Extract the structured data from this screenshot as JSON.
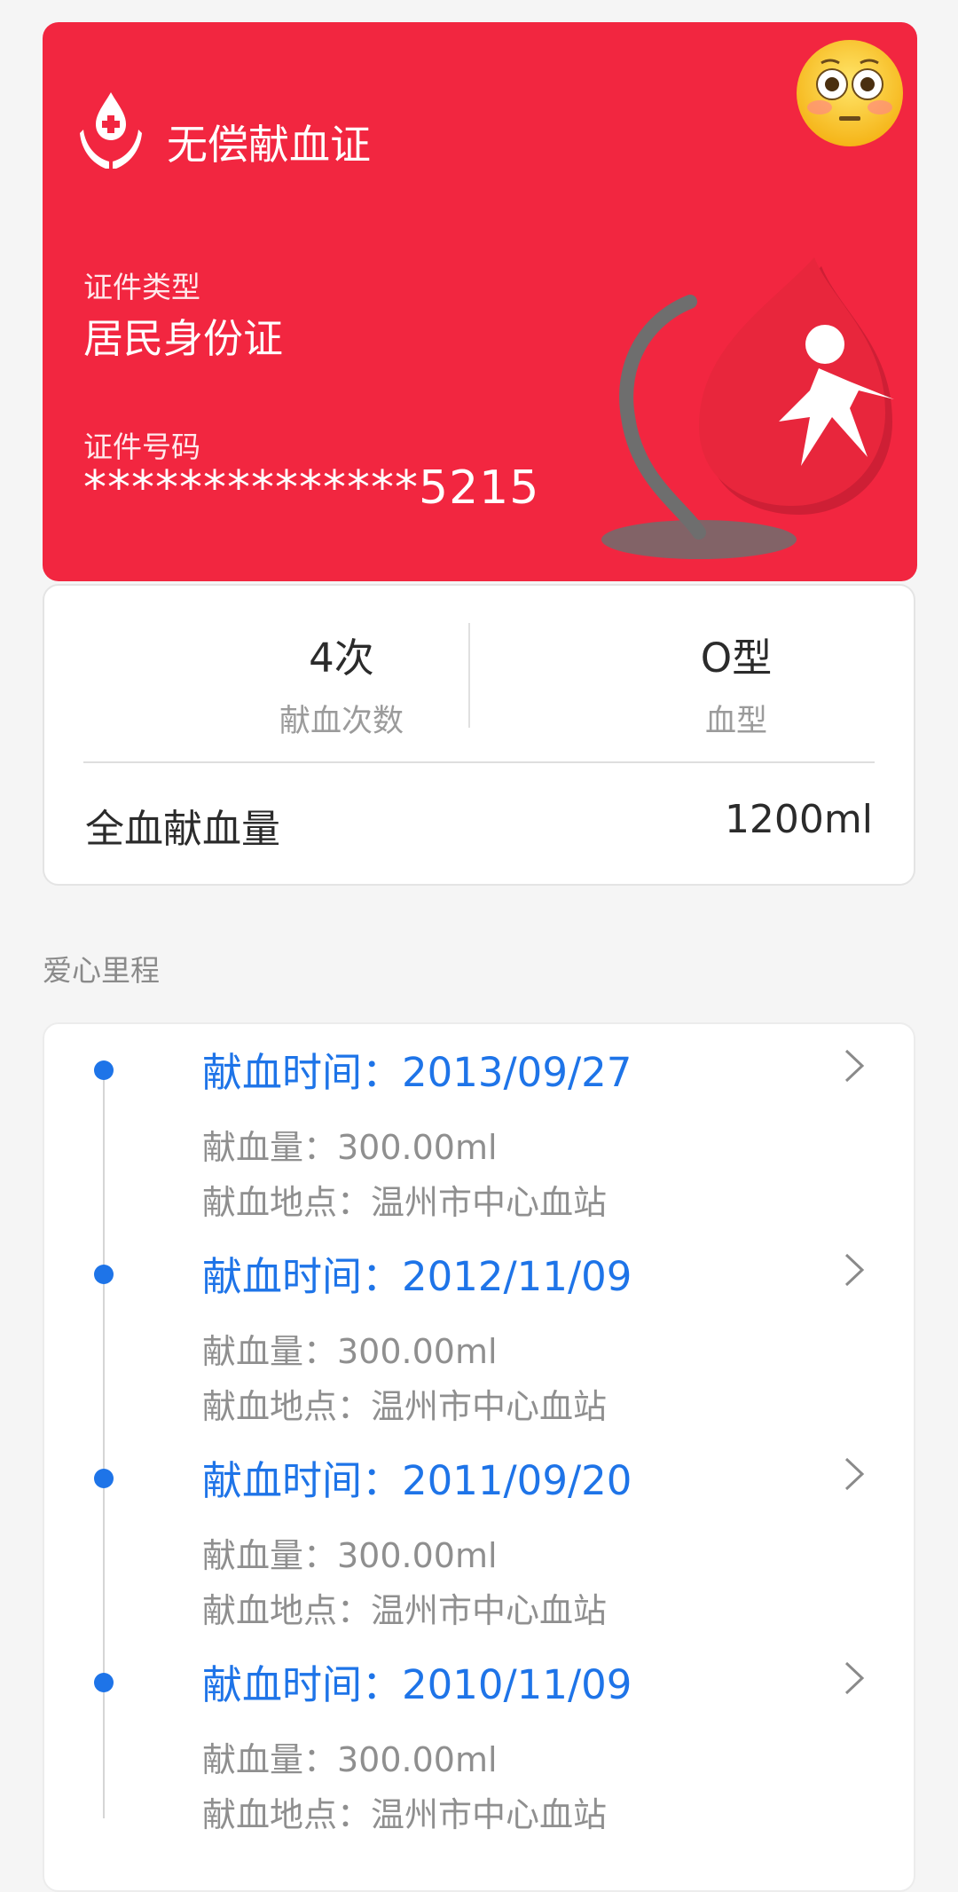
{
  "card": {
    "title": "无偿献血证",
    "id_type_label": "证件类型",
    "id_type_value": "居民身份证",
    "id_number_label": "证件号码",
    "id_number_value": "**************5215",
    "bg_color": "#f22640"
  },
  "stats": {
    "donations_value": "4次",
    "donations_label": "献血次数",
    "blood_type_value": "O型",
    "blood_type_label": "血型",
    "total_label": "全血献血量",
    "total_value": "1200ml"
  },
  "section_title": "爱心里程",
  "records": [
    {
      "time": "献血时间：2013/09/27",
      "amount": "献血量：300.00ml",
      "location": "献血地点：温州市中心血站"
    },
    {
      "time": "献血时间：2012/11/09",
      "amount": "献血量：300.00ml",
      "location": "献血地点：温州市中心血站"
    },
    {
      "time": "献血时间：2011/09/20",
      "amount": "献血量：300.00ml",
      "location": "献血地点：温州市中心血站"
    },
    {
      "time": "献血时间：2010/11/09",
      "amount": "献血量：300.00ml",
      "location": "献血地点：温州市中心血站"
    }
  ],
  "icons": [
    "blood-drop-hands-icon",
    "flushed-face-emoji",
    "blood-mascot-illustration",
    "chevron-right-icon"
  ],
  "accent_color": "#1e74e8"
}
